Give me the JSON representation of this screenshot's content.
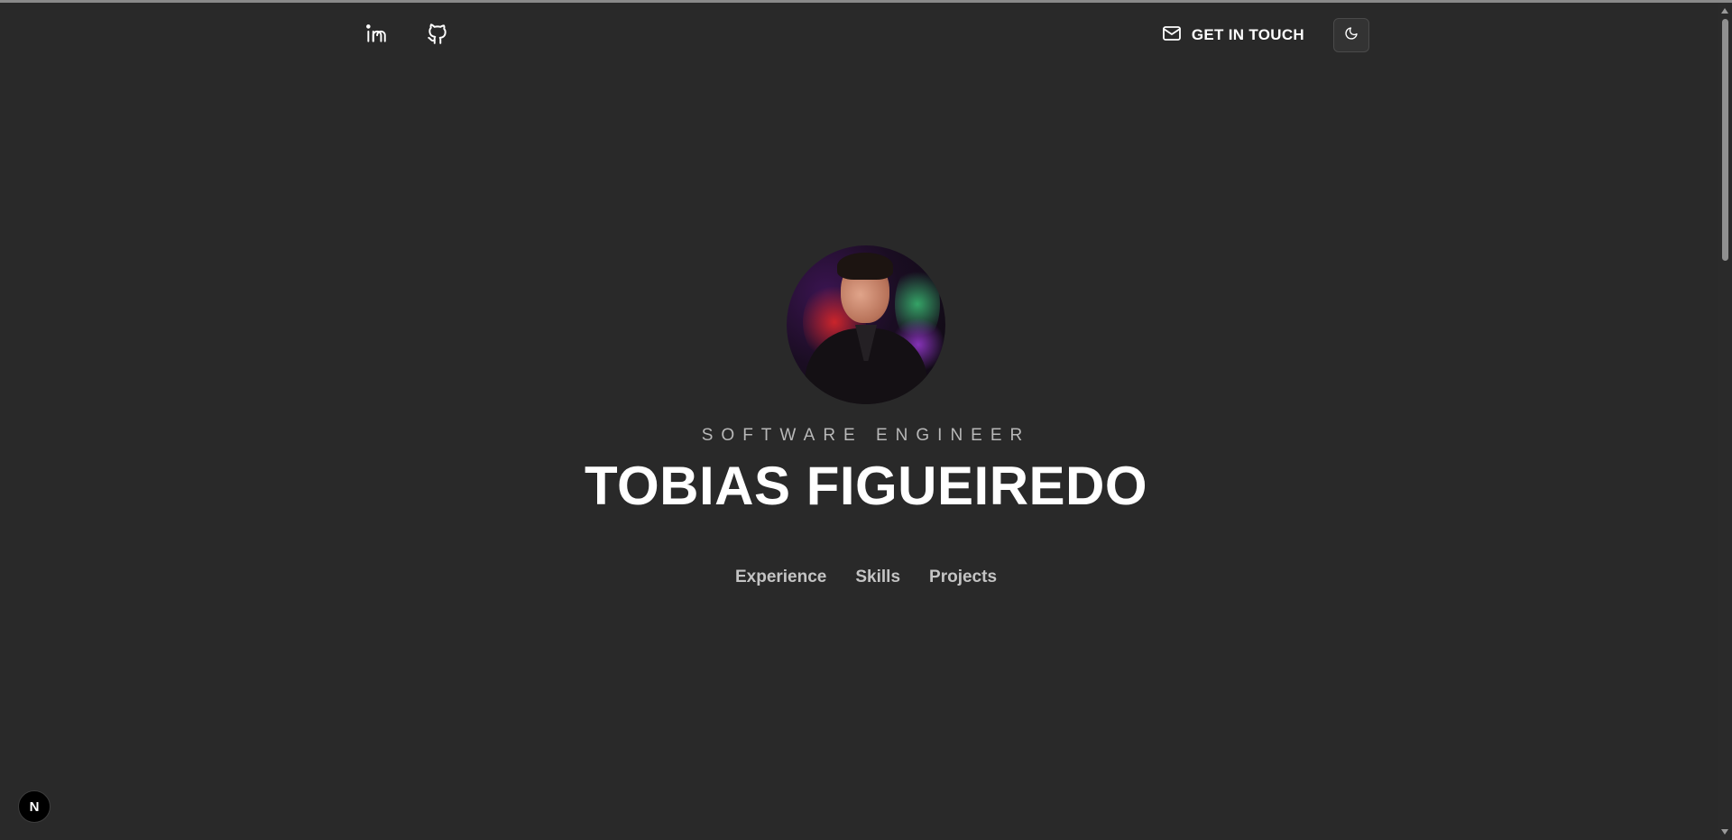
{
  "header": {
    "social": [
      {
        "icon": "linkedin-icon"
      },
      {
        "icon": "github-icon"
      }
    ],
    "contact_label": "GET IN TOUCH",
    "contact_icon": "mail-icon",
    "theme_icon": "moon-icon"
  },
  "hero": {
    "subtitle": "SOFTWARE ENGINEER",
    "name": "TOBIAS FIGUEIREDO"
  },
  "nav": {
    "items": [
      {
        "label": "Experience"
      },
      {
        "label": "Skills"
      },
      {
        "label": "Projects"
      }
    ]
  },
  "badge": {
    "label": "N"
  },
  "colors": {
    "background": "#292929",
    "text": "#ffffff",
    "muted": "#b8b8b8"
  }
}
